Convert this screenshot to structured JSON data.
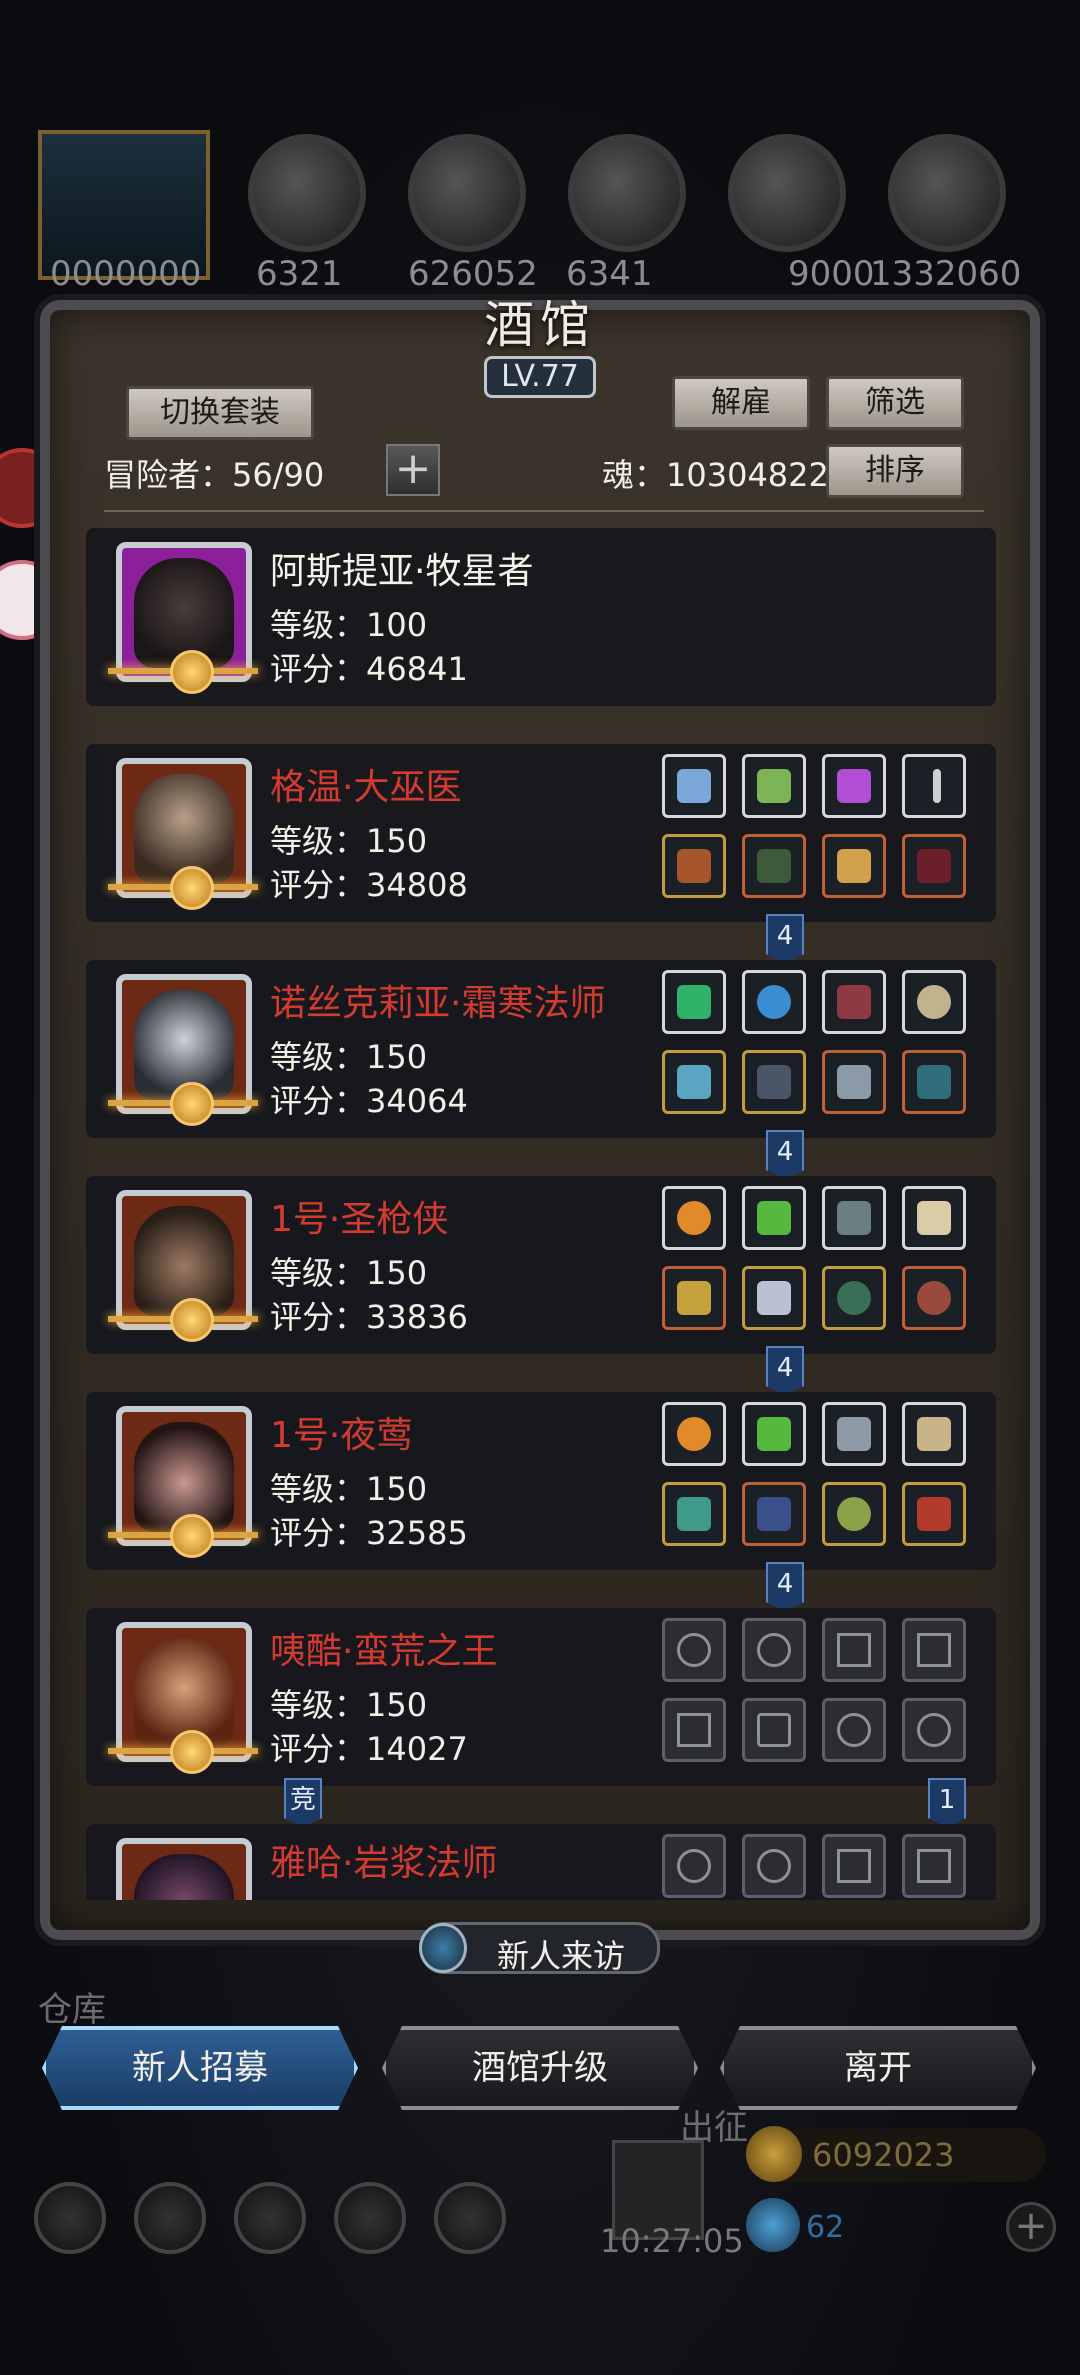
{
  "top_resources": {
    "values": [
      "6321",
      "626052",
      "6341",
      "9000",
      "1332060"
    ],
    "avatar_value": "0000000"
  },
  "tavern": {
    "title": "酒馆",
    "level": "LV.77",
    "switch_set_label": "切换套装",
    "dismiss_label": "解雇",
    "filter_label": "筛选",
    "sort_label": "排序",
    "adventurers_text": "冒险者：56/90",
    "soul_text": "魂：10304822",
    "plus_symbol": "+"
  },
  "adventurers": [
    {
      "name": "阿斯提亚·牧星者",
      "level": "等级：100",
      "score": "评分：46841"
    },
    {
      "name": "格温·大巫医",
      "level": "等级：150",
      "score": "评分：34808",
      "tag": "4"
    },
    {
      "name": "诺丝克莉亚·霜寒法师",
      "level": "等级：150",
      "score": "评分：34064",
      "tag": "4"
    },
    {
      "name": "1号·圣枪侠",
      "level": "等级：150",
      "score": "评分：33836",
      "tag": "4"
    },
    {
      "name": "1号·夜莺",
      "level": "等级：150",
      "score": "评分：32585",
      "tag": "4"
    },
    {
      "name": "咦酷·蛮荒之王",
      "level": "等级：150",
      "score": "评分：14027",
      "tag_left": "竞",
      "tag_right": "1"
    },
    {
      "name": "雅哈·岩浆法师"
    }
  ],
  "bottom": {
    "new_visitor_label": "新人来访",
    "recruit_label": "新人招募",
    "upgrade_label": "酒馆升级",
    "leave_label": "离开",
    "warehouse_label": "仓库",
    "expedition_label": "出征",
    "timer": "10:27:05",
    "gold": "6092023",
    "gems": "62",
    "gem_plus": "+"
  },
  "colors": {
    "name_red": "#d33b30",
    "primary_button": "#2e5f93"
  }
}
